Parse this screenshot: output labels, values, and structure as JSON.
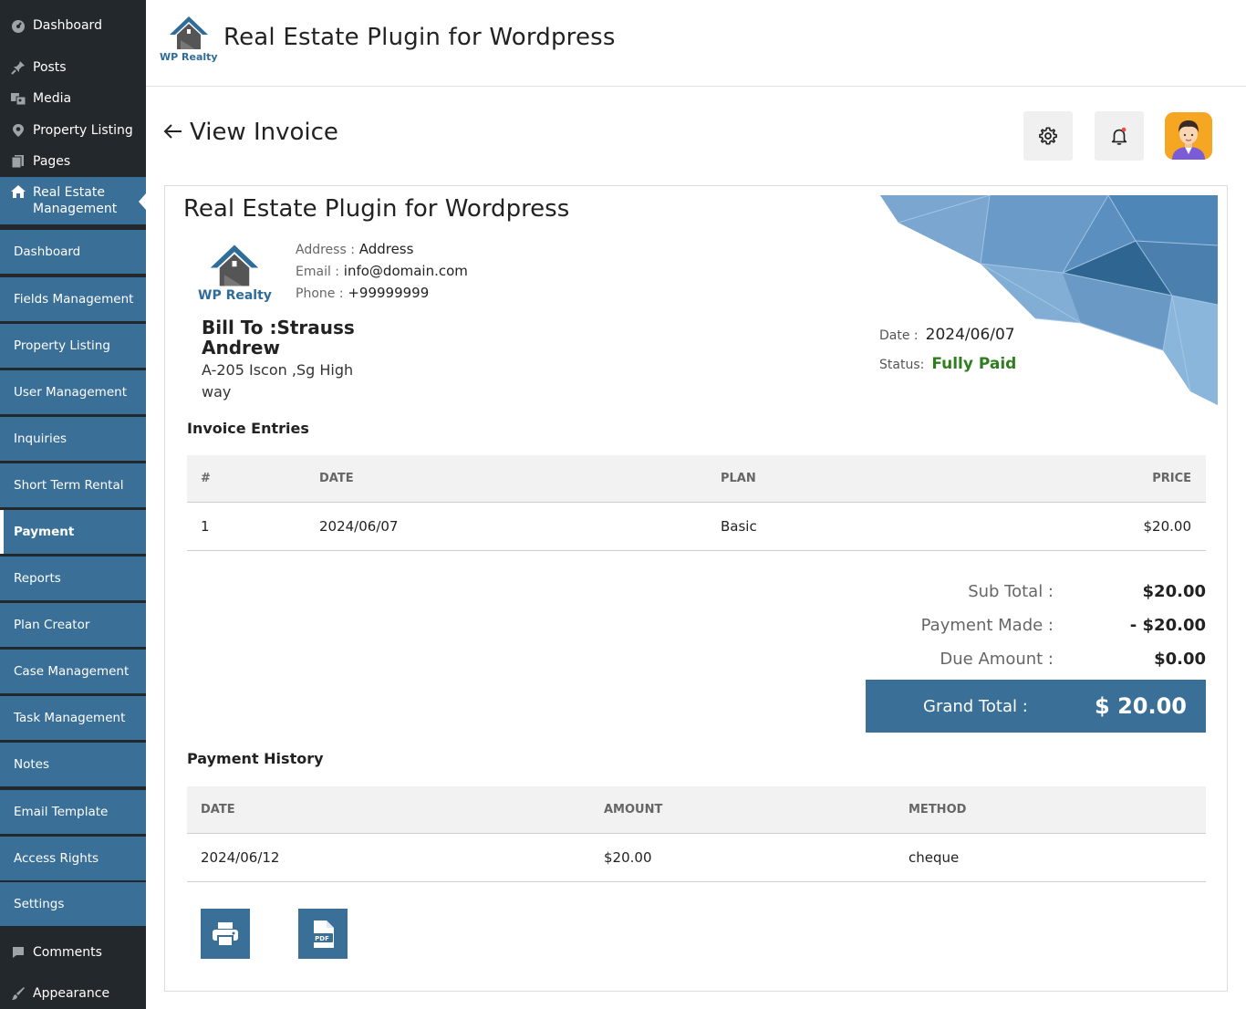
{
  "sidebar": {
    "top_items": [
      {
        "label": "Dashboard",
        "icon": "dashboard-icon"
      },
      {
        "label": "Posts",
        "icon": "pin-icon"
      },
      {
        "label": "Media",
        "icon": "media-icon"
      },
      {
        "label": "Property Listing",
        "icon": "location-pin-icon"
      },
      {
        "label": "Pages",
        "icon": "pages-icon"
      }
    ],
    "active_item": {
      "label": "Real Estate Management",
      "icon": "home-icon"
    },
    "sub_items": [
      "Dashboard",
      "Fields Management",
      "Property Listing",
      "User Management",
      "Inquiries",
      "Short Term Rental",
      "Payment",
      "Reports",
      "Plan Creator",
      "Case Management",
      "Task Management",
      "Notes",
      "Email Template",
      "Access Rights",
      "Settings"
    ],
    "current_sub": "Payment",
    "bottom_items": [
      {
        "label": "Comments",
        "icon": "comment-icon"
      },
      {
        "label": "Appearance",
        "icon": "brush-icon"
      }
    ]
  },
  "header": {
    "logo_text": "WP Realty",
    "title": "Real Estate Plugin for Wordpress"
  },
  "page": {
    "title": "View Invoice"
  },
  "invoice": {
    "company": "Real Estate Plugin for Wordpress",
    "logo_text": "WP Realty",
    "address_label": "Address :",
    "address": "Address",
    "email_label": "Email :",
    "email": "info@domain.com",
    "phone_label": "Phone :",
    "phone": "+99999999",
    "bill_to": "Bill To :Strauss Andrew",
    "bill_address": "A-205 Iscon ,Sg High way",
    "date_label": "Date :",
    "date": "2024/06/07",
    "status_label": "Status:",
    "status": "Fully Paid",
    "status_color": "#2e7d1f"
  },
  "entries": {
    "title": "Invoice Entries",
    "headers": [
      "#",
      "DATE",
      "PLAN",
      "PRICE"
    ],
    "rows": [
      [
        "1",
        "2024/06/07",
        "Basic",
        "$20.00"
      ]
    ]
  },
  "totals": {
    "sub_total_label": "Sub Total :",
    "sub_total": "$20.00",
    "payment_made_label": "Payment Made :",
    "payment_made": "- $20.00",
    "due_label": "Due Amount :",
    "due": "$0.00",
    "grand_label": "Grand Total :",
    "grand": "$ 20.00"
  },
  "history": {
    "title": "Payment History",
    "headers": [
      "DATE",
      "AMOUNT",
      "METHOD"
    ],
    "rows": [
      [
        "2024/06/12",
        "$20.00",
        "cheque"
      ]
    ]
  },
  "actions": [
    {
      "icon": "print-icon"
    },
    {
      "icon": "pdf-icon"
    }
  ],
  "colors": {
    "sidebar_bg": "#23282d",
    "accent": "#3a6f98"
  }
}
